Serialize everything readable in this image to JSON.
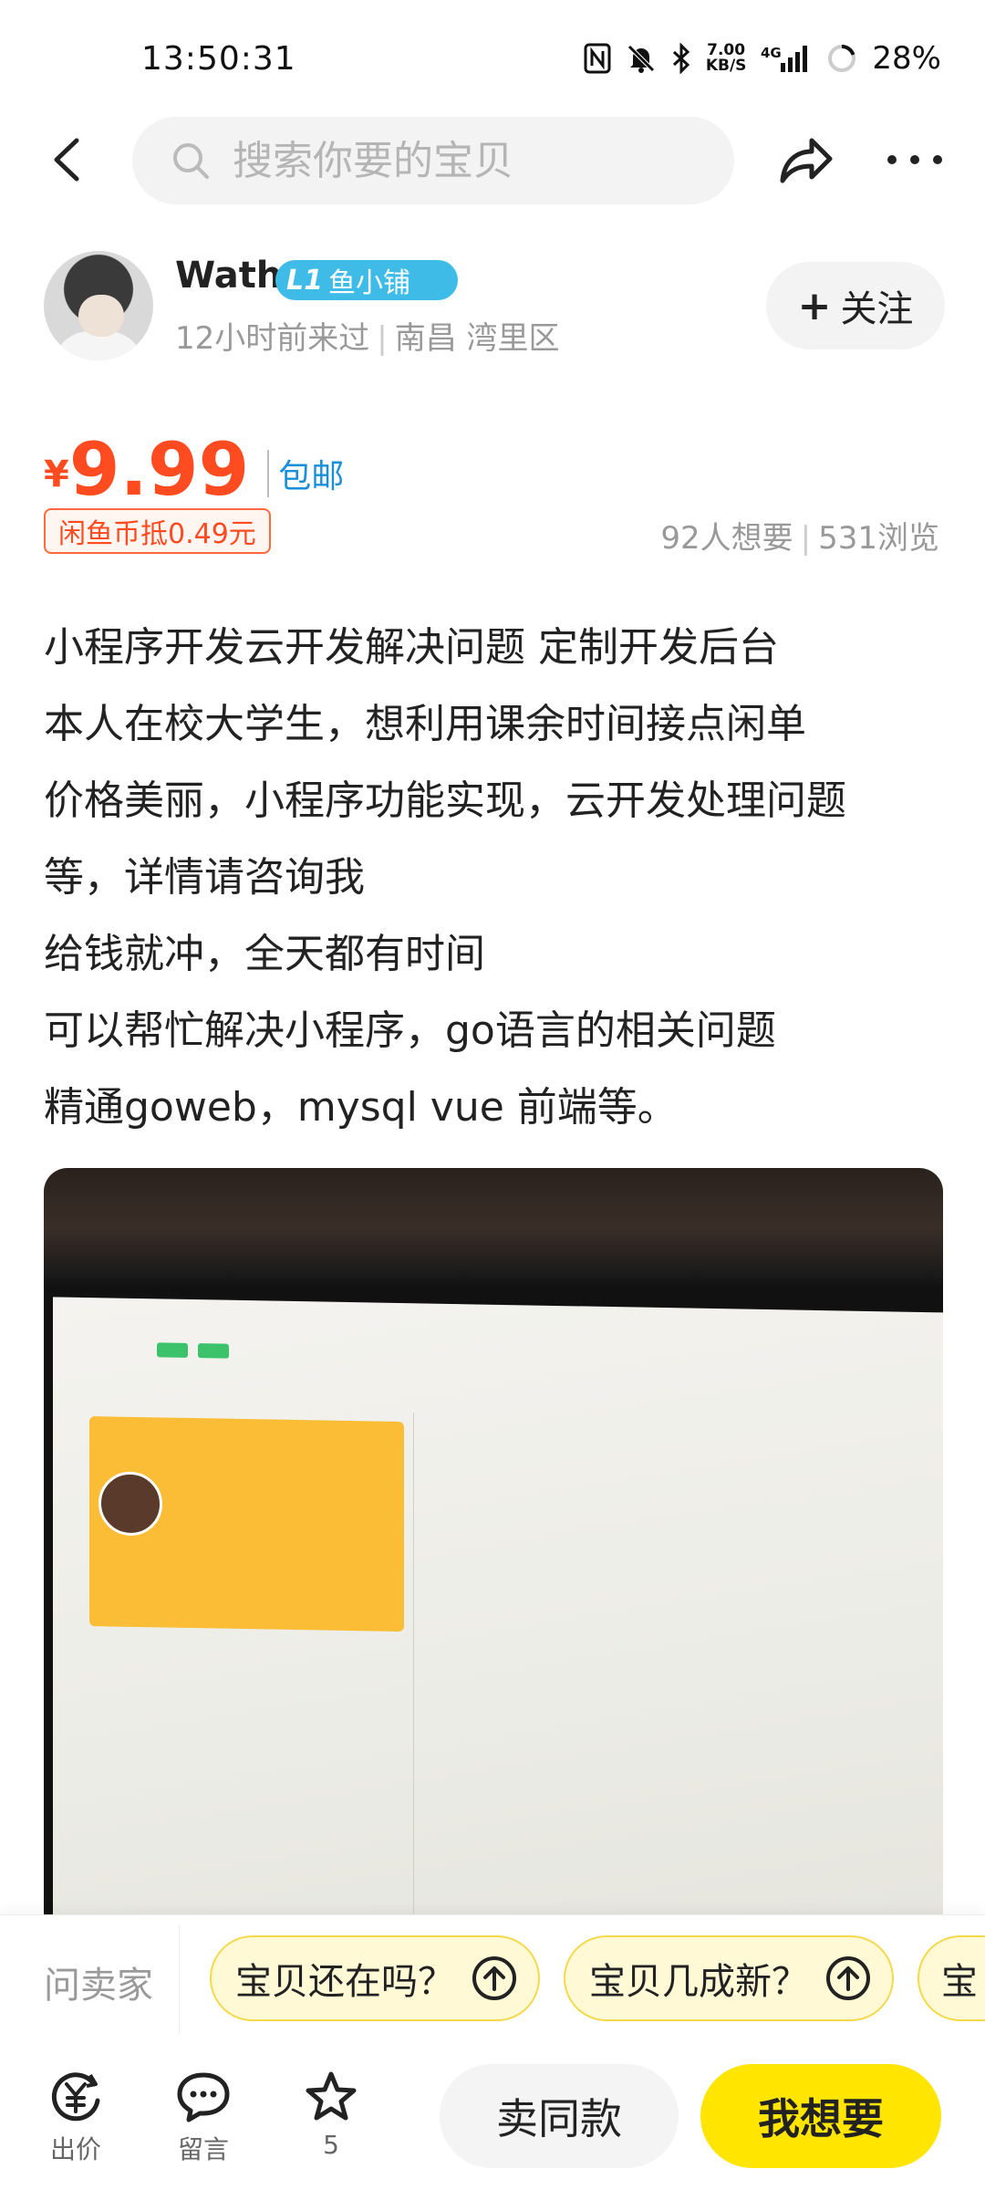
{
  "status_bar": {
    "time": "13:50:31",
    "net_speed_value": "7.00",
    "net_speed_unit": "KB/S",
    "network": "4G",
    "battery": "28%"
  },
  "search": {
    "placeholder": "搜索你要的宝贝"
  },
  "seller": {
    "name": "Wath",
    "badge_level": "L1",
    "badge_text": "鱼小铺",
    "last_seen": "12小时前来过",
    "location": "南昌 湾里区",
    "follow_label": "关注"
  },
  "price": {
    "currency": "¥",
    "value": "9.99",
    "shipping": "包邮",
    "coin_deduct": "闲鱼币抵0.49元",
    "wants": "92人想要",
    "views": "531浏览"
  },
  "description": {
    "lines": [
      "小程序开发云开发解决问题 定制开发后台",
      "本人在校大学生，想利用课余时间接点闲单",
      "价格美丽，小程序功能实现，云开发处理问题",
      "等，详情请咨询我",
      "给钱就冲，全天都有时间",
      "可以帮忙解决小程序，go语言的相关问题",
      "精通goweb，mysql  vue  前端等。"
    ]
  },
  "ask_bar": {
    "label": "问卖家",
    "questions": [
      "宝贝还在吗？",
      "宝贝几成新？",
      "宝"
    ]
  },
  "bottom_nav": {
    "offer": "出价",
    "comment": "留言",
    "favorite_count": "5",
    "same_label": "卖同款",
    "want_label": "我想要"
  }
}
